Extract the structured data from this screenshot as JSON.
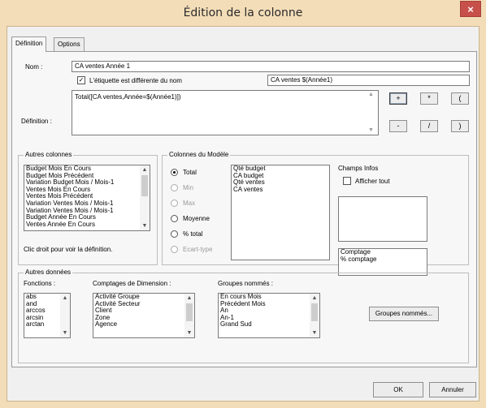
{
  "window": {
    "title": "Édition de la colonne",
    "close_glyph": "×",
    "accent": "#f3ddb8",
    "close_color": "#c7504a"
  },
  "tabs": [
    {
      "label": "Définition",
      "active": true
    },
    {
      "label": "Options",
      "active": false
    }
  ],
  "definition": {
    "nom_label": "Nom :",
    "nom_value": "CA ventes Année 1",
    "etiquette_checkbox_label": "L'étiquette est différente du nom",
    "etiquette_checked": true,
    "etiquette_value": "CA ventes $(Année1)",
    "definition_label": "Définition :",
    "definition_value": "Total([CA ventes,Année=$(Année1)])",
    "operator_buttons": [
      "+",
      "*",
      "(",
      "-",
      "/",
      ")"
    ]
  },
  "autres_colonnes": {
    "title": "Autres colonnes",
    "items": [
      "Budget Mois En Cours",
      "Budget Mois Précédent",
      "Variation Budget Mois / Mois-1",
      "Ventes Mois En Cours",
      "Ventes Mois Précédent",
      "Variation Ventes Mois / Mois-1",
      "Variation Ventes Mois / Mois-1",
      "Budget Année En Cours",
      "Ventes Année En Cours"
    ],
    "hint": "Clic droit pour voir la définition."
  },
  "colonnes_modele": {
    "title": "Colonnes du Modèle",
    "radios": [
      {
        "label": "Total",
        "selected": true,
        "enabled": true
      },
      {
        "label": "Min",
        "selected": false,
        "enabled": false
      },
      {
        "label": "Max",
        "selected": false,
        "enabled": false
      },
      {
        "label": "Moyenne",
        "selected": false,
        "enabled": true
      },
      {
        "label": "% total",
        "selected": false,
        "enabled": true
      },
      {
        "label": "Ecart-type",
        "selected": false,
        "enabled": false
      }
    ],
    "items": [
      "Qté budget",
      "CA budget",
      "Qté ventes",
      "CA ventes"
    ]
  },
  "champs_infos": {
    "title": "Champs Infos",
    "afficher_tout_label": "Afficher tout",
    "afficher_tout_checked": false,
    "list_items": [],
    "comptage_items": [
      "Comptage",
      "% comptage"
    ]
  },
  "autres_donnees": {
    "title": "Autres données",
    "fonctions_label": "Fonctions :",
    "fonctions_items": [
      "abs",
      "and",
      "arccos",
      "arcsin",
      "arctan"
    ],
    "comptages_label": "Comptages de Dimension :",
    "comptages_items": [
      "Activité Groupe",
      "Activité Secteur",
      "Client",
      "Zone",
      "Agence"
    ],
    "groupes_label": "Groupes nommés :",
    "groupes_items": [
      "En cours Mois",
      "Précédent Mois",
      "An",
      "An-1",
      "Grand Sud"
    ],
    "groupes_button": "Groupes nommés..."
  },
  "footer": {
    "ok": "OK",
    "cancel": "Annuler"
  },
  "icons": {
    "scroll_up": "▲",
    "scroll_down": "▼",
    "check": "✓"
  }
}
